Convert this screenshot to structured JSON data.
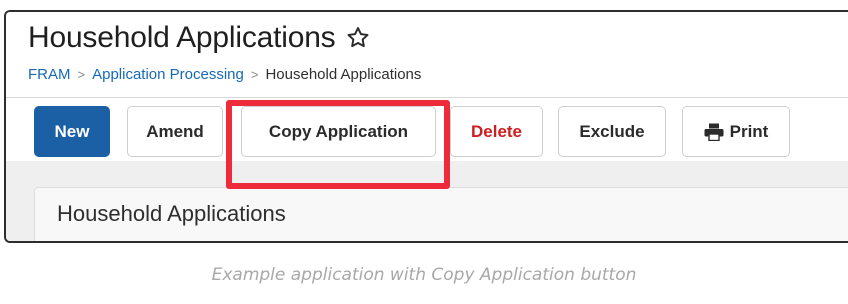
{
  "page": {
    "title": "Household Applications",
    "favorite_icon": "star-outline-icon"
  },
  "breadcrumb": {
    "items": [
      "FRAM",
      "Application Processing",
      "Household Applications"
    ],
    "separator": ">"
  },
  "toolbar": {
    "new_label": "New",
    "amend_label": "Amend",
    "copy_label": "Copy Application",
    "delete_label": "Delete",
    "exclude_label": "Exclude",
    "print_label": "Print",
    "print_icon": "printer-icon"
  },
  "panel": {
    "title": "Household Applications"
  },
  "caption": "Example application with Copy Application button",
  "colors": {
    "primary": "#1b5fa4",
    "link": "#1769b7",
    "danger": "#cc1f1f",
    "highlight": "#ee2b3b"
  }
}
